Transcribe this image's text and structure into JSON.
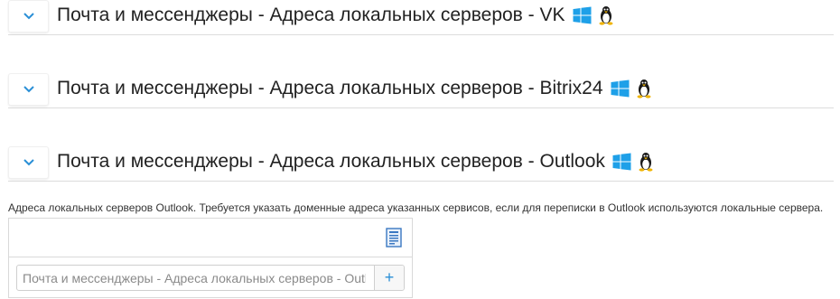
{
  "sections": [
    {
      "title": "Почта и мессенджеры - Адреса локальных серверов - VK",
      "os_icons": [
        "windows-icon",
        "linux-icon"
      ]
    },
    {
      "title": "Почта и мессенджеры - Адреса локальных серверов - Bitrix24",
      "os_icons": [
        "windows-icon",
        "linux-icon"
      ]
    },
    {
      "title": "Почта и мессенджеры - Адреса локальных серверов - Outlook",
      "os_icons": [
        "windows-icon",
        "linux-icon"
      ]
    }
  ],
  "expanded": {
    "description": "Адреса локальных серверов Outlook. Требуется указать доменные адреса указанных сервисов, если для переписки в Outlook используются локальные сервера.",
    "input_placeholder": "Почта и мессенджеры - Адреса локальных серверов - Outlook",
    "input_value": "",
    "add_button_label": "+"
  },
  "colors": {
    "accent": "#2a8fd6",
    "windows": "#1ea0e8",
    "divider": "#dcdcdc"
  }
}
